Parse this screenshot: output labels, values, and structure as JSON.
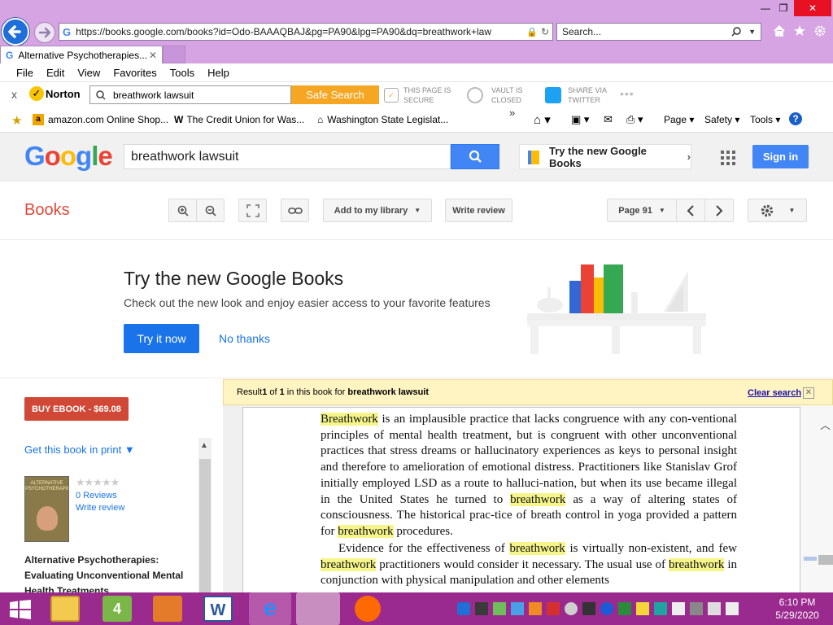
{
  "browser": {
    "url": "https://books.google.com/books?id=Odo-BAAAQBAJ&pg=PA90&lpg=PA90&dq=breathwork+law",
    "search_placeholder": "Search...",
    "tab_title": "Alternative Psychotherapies...",
    "menu": [
      "File",
      "Edit",
      "View",
      "Favorites",
      "Tools",
      "Help"
    ],
    "window_controls": {
      "minimize": "—",
      "restore": "❐",
      "close": "✕"
    }
  },
  "norton": {
    "brand": "Norton",
    "search_value": "breathwork lawsuit",
    "safe_search_label": "Safe Search",
    "page_secure_top": "THIS PAGE IS",
    "page_secure_bottom": "SECURE",
    "vault_top": "VAULT IS",
    "vault_bottom": "CLOSED",
    "share_top": "SHARE VIA",
    "share_bottom": "TWITTER",
    "close_x": "x",
    "more": "•••"
  },
  "favorites": {
    "items": [
      "amazon.com Online Shop...",
      "The Credit Union for Was...",
      "Washington State Legislat..."
    ],
    "chevron": "»",
    "commands": [
      "Page",
      "Safety",
      "Tools"
    ]
  },
  "google": {
    "search_value": "breathwork lawsuit",
    "try_new_label": "Try the new Google Books",
    "sign_in": "Sign in"
  },
  "books_toolbar": {
    "brand": "Books",
    "add_library": "Add to my library",
    "write_review": "Write review",
    "page_label": "Page 91"
  },
  "promo": {
    "title": "Try the new Google Books",
    "subtitle": "Check out the new look and enjoy easier access to your favorite features",
    "try_button": "Try it now",
    "no_thanks": "No thanks",
    "book_colors": [
      "#3367d6",
      "#ea4335",
      "#fbbc05",
      "#34a853"
    ]
  },
  "sidebar": {
    "buy": "BUY EBOOK - $69.08",
    "get_book": "Get this book in print ▼",
    "reviews": "0 Reviews",
    "write_review": "Write review",
    "stars": "★★★★★",
    "cover_title": "ALTERNATIVE PSYCHOTHERAPIES",
    "book_title": "Alternative Psychotherapies: Evaluating Unconventional Mental Health Treatments"
  },
  "result_bar": {
    "prefix": "Result ",
    "n": "1",
    "of": " of ",
    "total": "1",
    "mid": " in this book for ",
    "query": "breathwork lawsuit",
    "clear": "Clear search",
    "close": "✕"
  },
  "page_text": {
    "p1": [
      {
        "t": "Breathwork",
        "h": true
      },
      {
        "t": " is an implausible practice that lacks congruence with any con-ventional principles of mental health treatment, but is congruent with other unconventional practices that stress dreams or hallucinatory experiences as keys to personal insight and therefore to amelioration of emotional distress. Practitioners like Stanislav Grof initially employed LSD as a route to halluci-nation, but when its use became illegal in the United States he turned to ",
        "h": false
      },
      {
        "t": "breathwork",
        "h": true
      },
      {
        "t": " as a way of altering states of consciousness. The historical prac-tice of breath control in yoga provided a pattern for ",
        "h": false
      },
      {
        "t": "breathwork",
        "h": true
      },
      {
        "t": " procedures.",
        "h": false
      }
    ],
    "p2": [
      {
        "t": "Evidence for the effectiveness of ",
        "h": false
      },
      {
        "t": "breathwork",
        "h": true
      },
      {
        "t": " is virtually non-existent, and few ",
        "h": false
      },
      {
        "t": "breathwork",
        "h": true
      },
      {
        "t": " practitioners would consider it necessary. The usual use of ",
        "h": false
      },
      {
        "t": "breathwork",
        "h": true
      },
      {
        "t": " in conjunction with physical manipulation and other elements",
        "h": false
      }
    ]
  },
  "taskbar": {
    "time": "6:10 PM",
    "date": "5/29/2020"
  }
}
